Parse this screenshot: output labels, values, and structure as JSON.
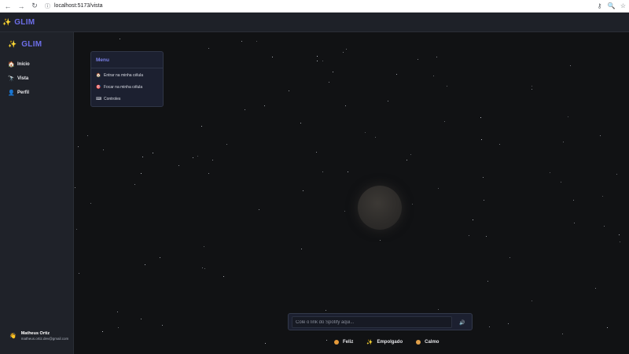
{
  "browser": {
    "url": "localhost:5173/vista",
    "back_icon": "←",
    "forward_icon": "→",
    "reload_icon": "↻",
    "info_icon": "ⓘ",
    "key_icon": "⚷",
    "zoom_icon": "🔍",
    "star_icon": "☆"
  },
  "app": {
    "brand": "GLIM",
    "brand_icon": "✨"
  },
  "sidebar": {
    "brand": "GLIM",
    "brand_icon": "✨",
    "items": [
      {
        "label": "Início",
        "icon": "🏠"
      },
      {
        "label": "Vista",
        "icon": "🔭"
      },
      {
        "label": "Perfil",
        "icon": "👤"
      }
    ],
    "user": {
      "icon": "👋",
      "name": "Matheus Ortiz",
      "email": "matheus.ortiz.dev@gmail.com"
    }
  },
  "menu": {
    "title": "Menu",
    "items": [
      {
        "label": "Entrar na minha célula",
        "icon": "🏠"
      },
      {
        "label": "Focar na minha célula",
        "icon": "🎯"
      },
      {
        "label": "Controles",
        "icon": "⌨"
      }
    ]
  },
  "player": {
    "placeholder": "Cole o link do Spotify aqui...",
    "speaker_icon": "🔊"
  },
  "moods": [
    {
      "label": "Feliz",
      "icon": "dot",
      "color": "#e59a3a"
    },
    {
      "label": "Empolgado",
      "icon": "✨",
      "color": "#f5c542"
    },
    {
      "label": "Calmo",
      "icon": "dot",
      "color": "#e0a04a"
    }
  ]
}
